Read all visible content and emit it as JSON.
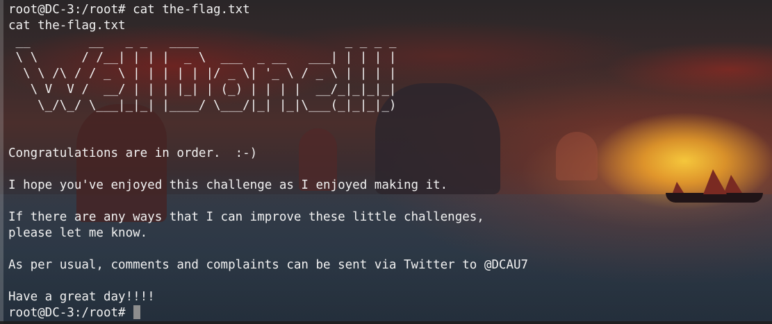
{
  "terminal": {
    "lines": [
      "root@DC-3:/root# cat the-flag.txt",
      "cat the-flag.txt",
      " __        __   _ _   ____                    _ _ _ _ ",
      " \\ \\      / /__| | | |  _ \\  ___  _ __   ___| | | | |",
      "  \\ \\ /\\ / / _ \\ | | | | | |/ _ \\| '_ \\ / _ \\ | | | |",
      "   \\ V  V /  __/ | | | |_| | (_) | | | |  __/_|_|_|_|",
      "    \\_/\\_/ \\___|_|_| |____/ \\___/|_| |_|\\___(_|_|_|_)",
      "",
      "",
      "Congratulations are in order.  :-)",
      "",
      "I hope you've enjoyed this challenge as I enjoyed making it.",
      "",
      "If there are any ways that I can improve these little challenges,",
      "please let me know.",
      "",
      "As per usual, comments and complaints can be sent via Twitter to @DCAU7",
      "",
      "Have a great day!!!!",
      "root@DC-3:/root# "
    ]
  },
  "colors": {
    "text": "#f2f2f2",
    "cursor": "#8e8e8e",
    "sun": "#facd3c",
    "sky_red": "#96201a"
  }
}
